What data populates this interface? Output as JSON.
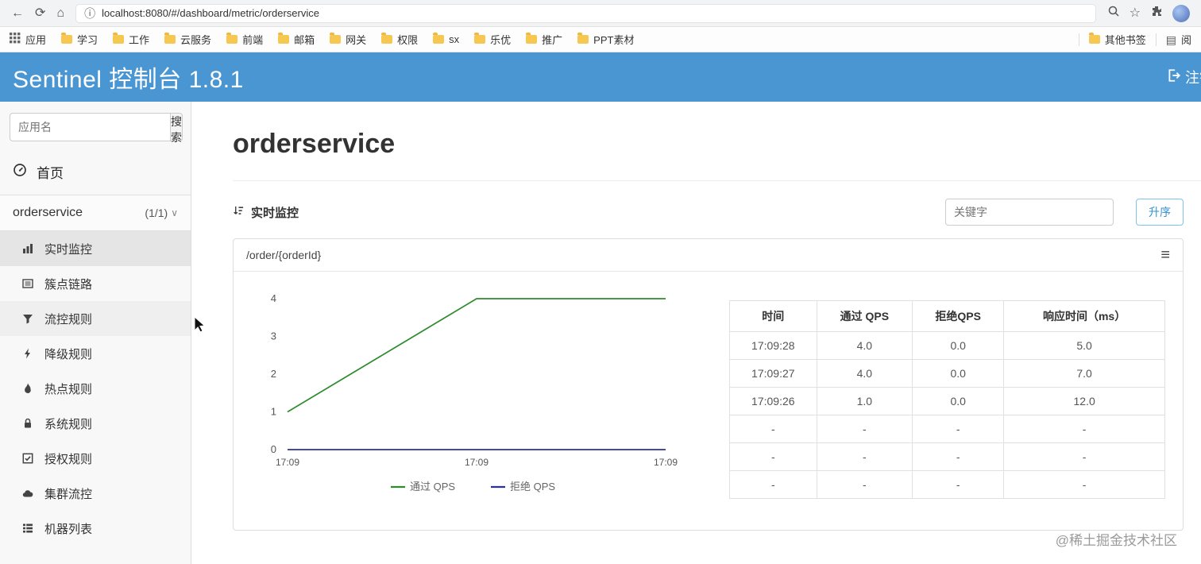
{
  "colors": {
    "header_bg": "#4a96d2",
    "pass_qps": "#2e8b2e",
    "block_qps": "#2e3192",
    "accent_blue": "#3492cf"
  },
  "browser": {
    "url": "localhost:8080/#/dashboard/metric/orderservice",
    "bookmarks": [
      {
        "label": "应用",
        "icon": "apps"
      },
      {
        "label": "学习",
        "icon": "folder"
      },
      {
        "label": "工作",
        "icon": "folder"
      },
      {
        "label": "云服务",
        "icon": "folder"
      },
      {
        "label": "前端",
        "icon": "folder"
      },
      {
        "label": "邮箱",
        "icon": "folder"
      },
      {
        "label": "网关",
        "icon": "folder"
      },
      {
        "label": "权限",
        "icon": "folder"
      },
      {
        "label": "sx",
        "icon": "folder"
      },
      {
        "label": "乐优",
        "icon": "folder"
      },
      {
        "label": "推广",
        "icon": "folder"
      },
      {
        "label": "PPT素材",
        "icon": "folder"
      }
    ],
    "other_bookmarks": "其他书签",
    "reading_list": "阅"
  },
  "header": {
    "title": "Sentinel 控制台 1.8.1",
    "logout_label": "注销"
  },
  "sidebar": {
    "search_placeholder": "应用名",
    "search_button": "搜索",
    "home_label": "首页",
    "app_name": "orderservice",
    "app_count": "(1/1)",
    "items": [
      {
        "label": "实时监控",
        "icon": "chart-bar",
        "state": "active"
      },
      {
        "label": "簇点链路",
        "icon": "list-alt",
        "state": ""
      },
      {
        "label": "流控规则",
        "icon": "filter",
        "state": "hover"
      },
      {
        "label": "降级规则",
        "icon": "bolt",
        "state": ""
      },
      {
        "label": "热点规则",
        "icon": "fire",
        "state": ""
      },
      {
        "label": "系统规则",
        "icon": "lock",
        "state": ""
      },
      {
        "label": "授权规则",
        "icon": "check-square",
        "state": ""
      },
      {
        "label": "集群流控",
        "icon": "cloud",
        "state": ""
      },
      {
        "label": "机器列表",
        "icon": "th-list",
        "state": ""
      }
    ]
  },
  "main": {
    "page_title": "orderservice",
    "section_title": "实时监控",
    "keyword_placeholder": "关键字",
    "sort_button": "升序",
    "card_title": "/order/{orderId}",
    "watermark": "@稀土掘金技术社区"
  },
  "chart_data": {
    "type": "line",
    "title": "",
    "x_ticks": [
      "17:09",
      "17:09",
      "17:09"
    ],
    "y_ticks": [
      0,
      1,
      2,
      3,
      4
    ],
    "ylim": [
      0,
      4
    ],
    "grid": false,
    "legend_position": "bottom",
    "series": [
      {
        "name": "通过 QPS",
        "color": "#2e8b2e",
        "values": [
          1,
          2,
          3,
          4,
          4,
          4,
          4
        ]
      },
      {
        "name": "拒绝 QPS",
        "color": "#2e3192",
        "values": [
          0,
          0,
          0,
          0,
          0,
          0,
          0
        ]
      }
    ]
  },
  "table": {
    "headers": [
      "时间",
      "通过 QPS",
      "拒绝QPS",
      "响应时间（ms）"
    ],
    "rows": [
      [
        "17:09:28",
        "4.0",
        "0.0",
        "5.0"
      ],
      [
        "17:09:27",
        "4.0",
        "0.0",
        "7.0"
      ],
      [
        "17:09:26",
        "1.0",
        "0.0",
        "12.0"
      ],
      [
        "-",
        "-",
        "-",
        "-"
      ],
      [
        "-",
        "-",
        "-",
        "-"
      ],
      [
        "-",
        "-",
        "-",
        "-"
      ]
    ]
  }
}
